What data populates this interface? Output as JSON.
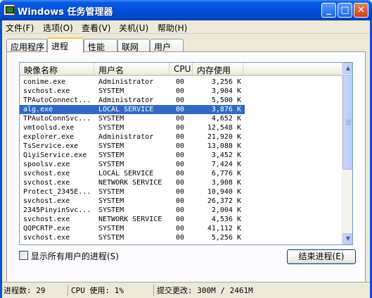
{
  "window": {
    "title": "Windows 任务管理器",
    "controls": {
      "minimize": "_",
      "maximize": "□",
      "close": "✕"
    }
  },
  "menu": [
    "文件(F)",
    "选项(O)",
    "查看(V)",
    "关机(U)",
    "帮助(H)"
  ],
  "tabs": [
    "应用程序",
    "进程",
    "性能",
    "联网",
    "用户"
  ],
  "active_tab": "进程",
  "columns": [
    "映像名称",
    "用户名",
    "CPU",
    "内存使用"
  ],
  "processes": [
    {
      "name": "conime.exe",
      "user": "Administrator",
      "cpu": "00",
      "mem": "3,256 K"
    },
    {
      "name": "svchost.exe",
      "user": "SYSTEM",
      "cpu": "00",
      "mem": "3,904 K"
    },
    {
      "name": "TPAutoConnect...",
      "user": "Administrator",
      "cpu": "00",
      "mem": "5,500 K"
    },
    {
      "name": "alg.exe",
      "user": "LOCAL SERVICE",
      "cpu": "00",
      "mem": "3,876 K",
      "selected": true
    },
    {
      "name": "TPAutoConnSvc...",
      "user": "SYSTEM",
      "cpu": "00",
      "mem": "4,652 K"
    },
    {
      "name": "vmtoolsd.exe",
      "user": "SYSTEM",
      "cpu": "00",
      "mem": "12,548 K"
    },
    {
      "name": "explorer.exe",
      "user": "Administrator",
      "cpu": "00",
      "mem": "21,920 K"
    },
    {
      "name": "TsService.exe",
      "user": "SYSTEM",
      "cpu": "00",
      "mem": "13,088 K"
    },
    {
      "name": "QiyiService.exe",
      "user": "SYSTEM",
      "cpu": "00",
      "mem": "3,452 K"
    },
    {
      "name": "spoolsv.exe",
      "user": "SYSTEM",
      "cpu": "00",
      "mem": "7,424 K"
    },
    {
      "name": "svchost.exe",
      "user": "LOCAL SERVICE",
      "cpu": "00",
      "mem": "6,776 K"
    },
    {
      "name": "svchost.exe",
      "user": "NETWORK SERVICE",
      "cpu": "00",
      "mem": "3,908 K"
    },
    {
      "name": "Protect_2345E...",
      "user": "SYSTEM",
      "cpu": "00",
      "mem": "10,940 K"
    },
    {
      "name": "svchost.exe",
      "user": "SYSTEM",
      "cpu": "00",
      "mem": "26,372 K"
    },
    {
      "name": "2345PinyinSvc...",
      "user": "SYSTEM",
      "cpu": "00",
      "mem": "2,004 K"
    },
    {
      "name": "svchost.exe",
      "user": "NETWORK SERVICE",
      "cpu": "00",
      "mem": "4,536 K"
    },
    {
      "name": "QQPCRTP.exe",
      "user": "SYSTEM",
      "cpu": "00",
      "mem": "41,112 K"
    },
    {
      "name": "svchost.exe",
      "user": "SYSTEM",
      "cpu": "00",
      "mem": "5,256 K"
    }
  ],
  "show_all_users_label": "显示所有用户的进程(S)",
  "end_process_label": "结束进程(E)",
  "status": {
    "processes": "进程数: 29",
    "cpu": "CPU 使用: 1%",
    "commit": "提交更改: 300M / 2461M"
  }
}
